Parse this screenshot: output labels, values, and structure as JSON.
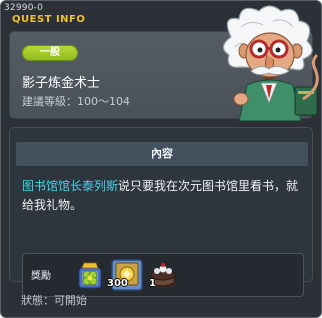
{
  "window": {
    "quest_id": "32990-0",
    "title": "QUEST INFO"
  },
  "header": {
    "type_badge": "一般",
    "quest_name": "影子炼金术士",
    "level_requirement": "建議等級：100～104"
  },
  "npc": {
    "icon": "professor-npc-portrait"
  },
  "content": {
    "header": "內容",
    "npc_name": "图书馆馆长泰列斯",
    "description_text": "说只要我在次元图书馆里看书，就给我礼物。"
  },
  "rewards": {
    "label": "獎勵",
    "items": [
      {
        "icon": "clover-box-icon",
        "count": ""
      },
      {
        "icon": "gold-coin-scroll-icon",
        "count": "300"
      },
      {
        "icon": "cake-pot-icon",
        "count": "1"
      }
    ]
  },
  "status": {
    "text": "狀態：可開始"
  },
  "colors": {
    "title": "#f0c02a",
    "badge": "#a6cc2b",
    "npc_link": "#43d4e6"
  }
}
